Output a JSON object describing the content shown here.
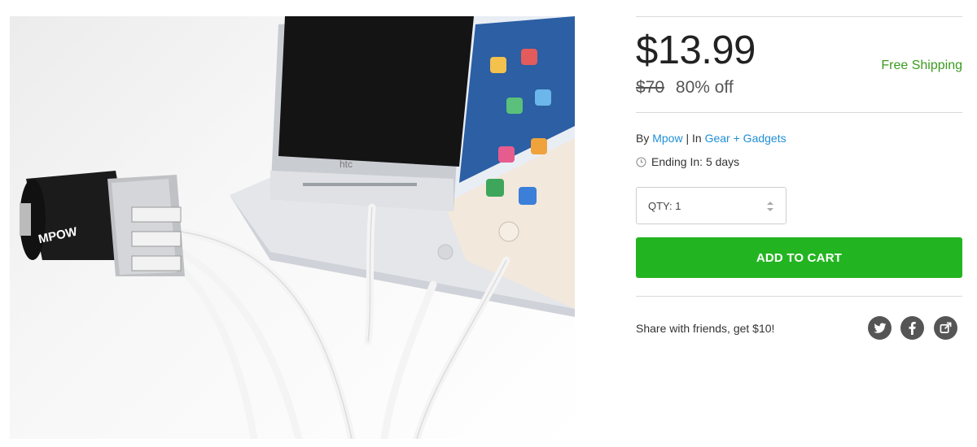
{
  "product": {
    "image_alt": "Mpow car charger charging phones and tablet",
    "charger_brand": "MPOW",
    "phone_brand": "htc"
  },
  "pricing": {
    "price": "$13.99",
    "shipping": "Free Shipping",
    "original_price": "$70",
    "discount": "80% off"
  },
  "meta": {
    "by_label": "By",
    "brand": "Mpow",
    "separator": "|",
    "in_label": "In",
    "category": "Gear + Gadgets",
    "ending": "Ending In: 5 days"
  },
  "quantity": {
    "label": "QTY: 1"
  },
  "cart": {
    "button_label": "ADD TO CART"
  },
  "share": {
    "text": "Share with friends, get $10!",
    "icons": [
      "twitter-icon",
      "facebook-icon",
      "share-icon"
    ]
  },
  "colors": {
    "accent_green": "#23b521",
    "shipping_green": "#3b9b20",
    "link_blue": "#1f8fd6",
    "social_gray": "#555555"
  }
}
